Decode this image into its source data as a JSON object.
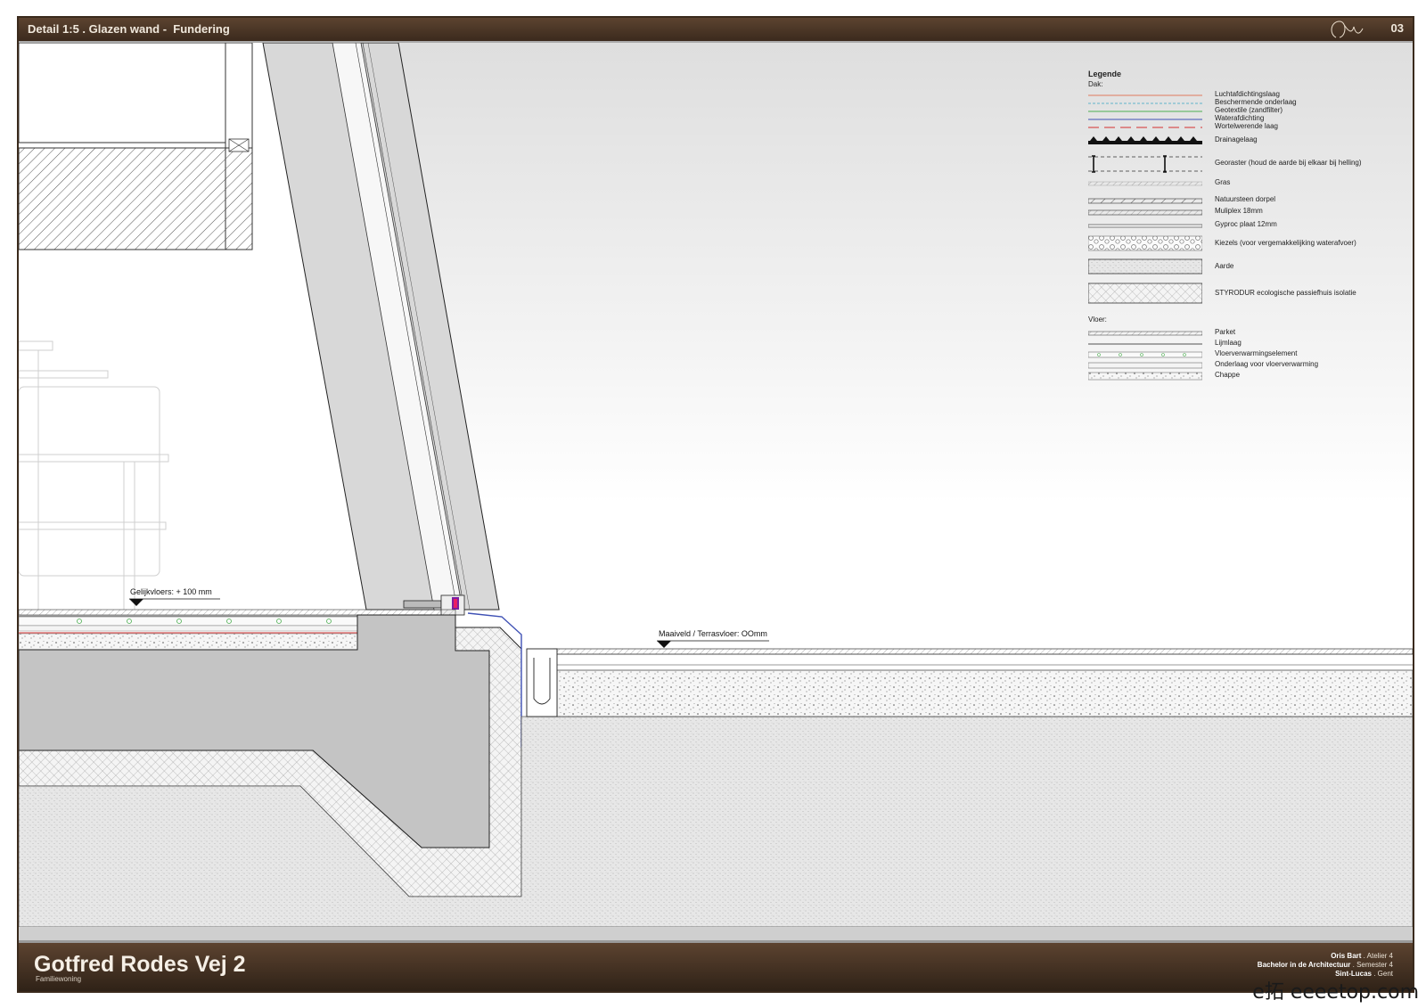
{
  "header": {
    "title": "Detail 1:5 . Glazen wand -  Fundering",
    "page_number": "03"
  },
  "footer": {
    "project_name": "Gotfred Rodes Vej 2",
    "project_type": "Familiewoning",
    "credits": [
      {
        "bold": "Oris Bart",
        "rest": " . Atelier 4"
      },
      {
        "bold": "Bachelor in de Architectuur",
        "rest": " . Semester 4"
      },
      {
        "bold": "Sint-Lucas",
        "rest": " . Gent"
      }
    ]
  },
  "levels": {
    "interior": "Gelijkvloers:  + 100 mm",
    "exterior": "Maaiveld / Terrasvloer: OOmm"
  },
  "legend": {
    "title": "Legende",
    "roof_heading": "Dak:",
    "floor_heading": "Vloer:",
    "roof_items": [
      {
        "label": "Luchtafdichtingslaag",
        "pattern": "line",
        "color": "#e07a5f"
      },
      {
        "label": "Beschermende onderlaag",
        "pattern": "dashed-line",
        "color": "#5fb3c9"
      },
      {
        "label": "Geotextile (zandfilter)",
        "pattern": "line",
        "color": "#4caf50"
      },
      {
        "label": "Waterafdichting",
        "pattern": "line",
        "color": "#3f51b5"
      },
      {
        "label": "Wortelwerende laag",
        "pattern": "long-dash",
        "color": "#d32f2f"
      },
      {
        "label": "Drainagelaag",
        "pattern": "drainage"
      },
      {
        "label": "Georaster (houd de aarde bij elkaar bij helling)",
        "pattern": "georaster"
      },
      {
        "label": "Gras",
        "pattern": "grass"
      },
      {
        "label": "Natuursteen dorpel",
        "pattern": "hatch-strip"
      },
      {
        "label": "Muliplex 18mm",
        "pattern": "hatch-strip-light"
      },
      {
        "label": "Gyproc plaat 12mm",
        "pattern": "thin-strip"
      },
      {
        "label": "Kiezels (voor vergemakkelijking waterafvoer)",
        "pattern": "pebbles"
      },
      {
        "label": "Aarde",
        "pattern": "earth"
      },
      {
        "label": "STYRODUR ecologische passiefhuis isolatie",
        "pattern": "crosshatch"
      }
    ],
    "floor_items": [
      {
        "label": "Parket",
        "pattern": "hatch-strip-light"
      },
      {
        "label": "Lijmlaag",
        "pattern": "line",
        "color": "#888888"
      },
      {
        "label": "Vloerverwarmingselement",
        "pattern": "dots-strip"
      },
      {
        "label": "Onderlaag voor vloerverwarming",
        "pattern": "thin-strip"
      },
      {
        "label": "Chappe",
        "pattern": "speckle-strip"
      }
    ]
  },
  "watermark": "e拓 eeeetop.com",
  "colors": {
    "frame": "#3a2a1c",
    "bar": "#4a3526",
    "concrete": "#c4c4c4",
    "earth": "#e9e9e9"
  }
}
